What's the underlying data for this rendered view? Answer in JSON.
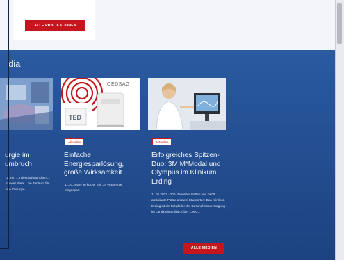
{
  "publications": {
    "button_label": "ALLE PUBLIKATIONEN"
  },
  "media": {
    "heading": "dia",
    "cards": [
      {
        "tag": "",
        "title": "urgie im umbruch",
        "text": "Dr. rer. ... ndespital München ... loowert shea ... he Zentrum für ... erie Chirurgie"
      },
      {
        "tag": "Aktuelles",
        "title": "Einfache Energiesparlösung, große Wirksamkeit",
        "text": "11.07.2023 · In kurzer Zeit 34 % Energie eingespart"
      },
      {
        "tag": "Aktuelles",
        "title": "Erfolgreiches Spitzen-Duo: 3M M*Modal und Olympus im Klinikum Erding",
        "text": "11.05.2023 · 200 stationäre Betten und zwölf ambulante Plätze an zwei Standorten: Das Klinikum Erding ist ein Eckpfeiler der Gesundheitsversorgung im Landkreis Erding. Über 1.000..."
      }
    ],
    "image2_brand": "OEDSAG",
    "image2_product": "TED",
    "button_label": "ALLE MEDIEN"
  },
  "colors": {
    "accent_red": "#c4161c",
    "band_blue": "#244f92"
  }
}
